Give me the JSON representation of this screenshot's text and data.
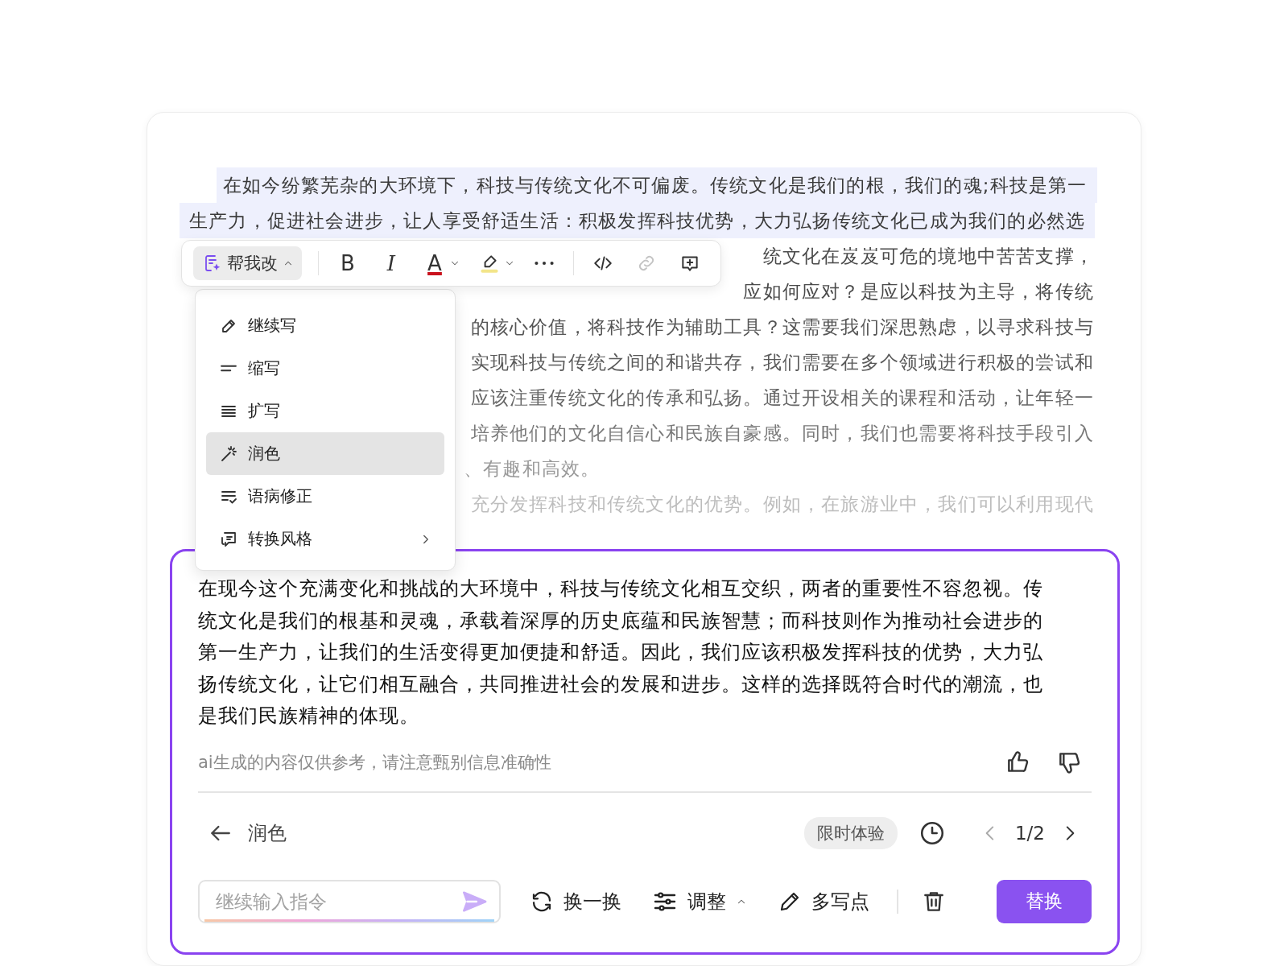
{
  "document": {
    "lines": [
      {
        "text": "在如今纷繁芜杂的大环境下，科技与传统文化不可偏废。传统文化是我们的根，我们的魂;科技是第一",
        "highlighted": true
      },
      {
        "text": "生产力，促进社会进步，让人享受舒适生活：积极发挥科技优势，大力弘扬传统文化已成为我们的必然选",
        "highlighted": true
      },
      {
        "text": "统文化在岌岌可危的境地中苦苦支撑，",
        "highlighted": false
      },
      {
        "text": "应如何应对？是应以科技为主导，将传统",
        "highlighted": false
      },
      {
        "text": "的核心价值，将科技作为辅助工具？这需要我们深思熟虑，以寻求科技与",
        "highlighted": false
      },
      {
        "text": "实现科技与传统之间的和谐共存，我们需要在多个领域进行积极的尝试和",
        "highlighted": false
      },
      {
        "text": "应该注重传统文化的传承和弘扬。通过开设相关的课程和活动，让年轻一",
        "highlighted": false
      },
      {
        "text": "培养他们的文化自信心和民族自豪感。同时，我们也需要将科技手段引入",
        "highlighted": false
      },
      {
        "text": "、有趣和高效。",
        "highlighted": false
      },
      {
        "text": "充分发挥科技和传统文化的优势。例如，在旅游业中，我们可以利用现代",
        "highlighted": false
      }
    ]
  },
  "toolbar": {
    "groups": [
      [
        {
          "kind": "ai",
          "label": "帮我改",
          "expanded": true,
          "disabled": false
        }
      ],
      [
        {
          "kind": "bold",
          "glyph": "B",
          "disabled": false
        },
        {
          "kind": "italic",
          "glyph": "I",
          "disabled": false
        },
        {
          "kind": "font_color",
          "glyph": "A",
          "has_menu": true,
          "disabled": false
        },
        {
          "kind": "highlight",
          "has_menu": true,
          "disabled": false
        },
        {
          "kind": "more",
          "disabled": false
        }
      ],
      [
        {
          "kind": "code",
          "disabled": false
        },
        {
          "kind": "link",
          "disabled": true
        },
        {
          "kind": "comment",
          "disabled": false
        }
      ]
    ]
  },
  "menu": {
    "items": [
      {
        "kind": "continue",
        "label": "继续写",
        "selected": false
      },
      {
        "kind": "shorten",
        "label": "缩写",
        "selected": false
      },
      {
        "kind": "expand",
        "label": "扩写",
        "selected": false
      },
      {
        "kind": "polish",
        "label": "润色",
        "selected": true
      },
      {
        "kind": "grammar",
        "label": "语病修正",
        "selected": false
      },
      {
        "kind": "style",
        "label": "转换风格",
        "selected": false,
        "has_submenu": true
      }
    ]
  },
  "result": {
    "text": "在现今这个充满变化和挑战的大环境中，科技与传统文化相互交织，两者的重要性不容忽视。传统文化是我们的根基和灵魂，承载着深厚的历史底蕴和民族智慧；而科技则作为推动社会进步的第一生产力，让我们的生活变得更加便捷和舒适。因此，我们应该积极发挥科技的优势，大力弘扬传统文化，让它们相互融合，共同推进社会的发展和进步。这样的选择既符合时代的潮流，也是我们民族精神的体现。",
    "disclaimer": "ai生成的内容仅供参考，请注意甄别信息准确性",
    "mode": "润色",
    "badge": "限时体验",
    "pager": {
      "text": "1/2",
      "prev_disabled": true,
      "next_disabled": false
    },
    "input": {
      "placeholder": "继续输入指令"
    },
    "actions": [
      {
        "kind": "refresh",
        "label": "换一换"
      },
      {
        "kind": "adjust",
        "label": "调整",
        "has_menu": true
      },
      {
        "kind": "write_more",
        "label": "多写点"
      }
    ],
    "replace_button": "替换"
  }
}
